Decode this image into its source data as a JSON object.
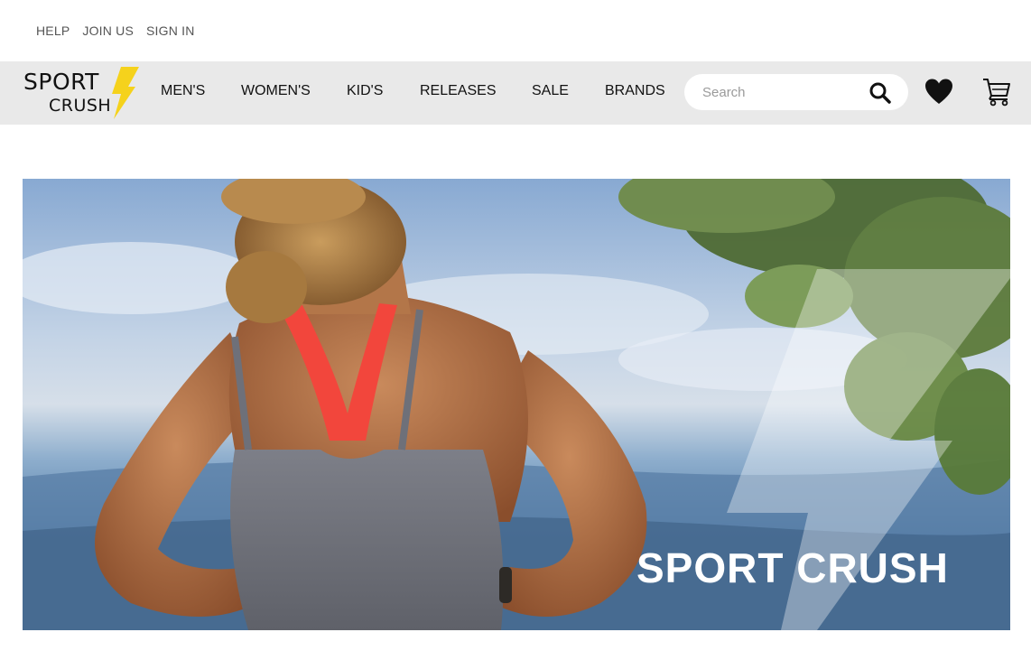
{
  "utility_nav": {
    "help": "HELP",
    "join_us": "JOIN US",
    "sign_in": "SIGN IN"
  },
  "logo": {
    "line1": "SPORT",
    "line2": "CRUSH",
    "bolt_color": "#f5d21c"
  },
  "main_nav": {
    "items": [
      {
        "label": "MEN'S"
      },
      {
        "label": "WOMEN'S"
      },
      {
        "label": "KID'S"
      },
      {
        "label": "RELEASES"
      },
      {
        "label": "SALE"
      },
      {
        "label": "BRANDS"
      }
    ]
  },
  "search": {
    "placeholder": "Search",
    "value": "",
    "icon": "search-icon"
  },
  "actions": {
    "wishlist_icon": "heart-icon",
    "cart_icon": "cart-icon"
  },
  "hero": {
    "title": "SPORT CRUSH",
    "image": "hero-photo-woman-athlete-overlooking-valley"
  },
  "colors": {
    "nav_background": "#e9e9e9",
    "text": "#111111",
    "utility_text": "#555555",
    "accent_bolt": "#f5d21c"
  }
}
